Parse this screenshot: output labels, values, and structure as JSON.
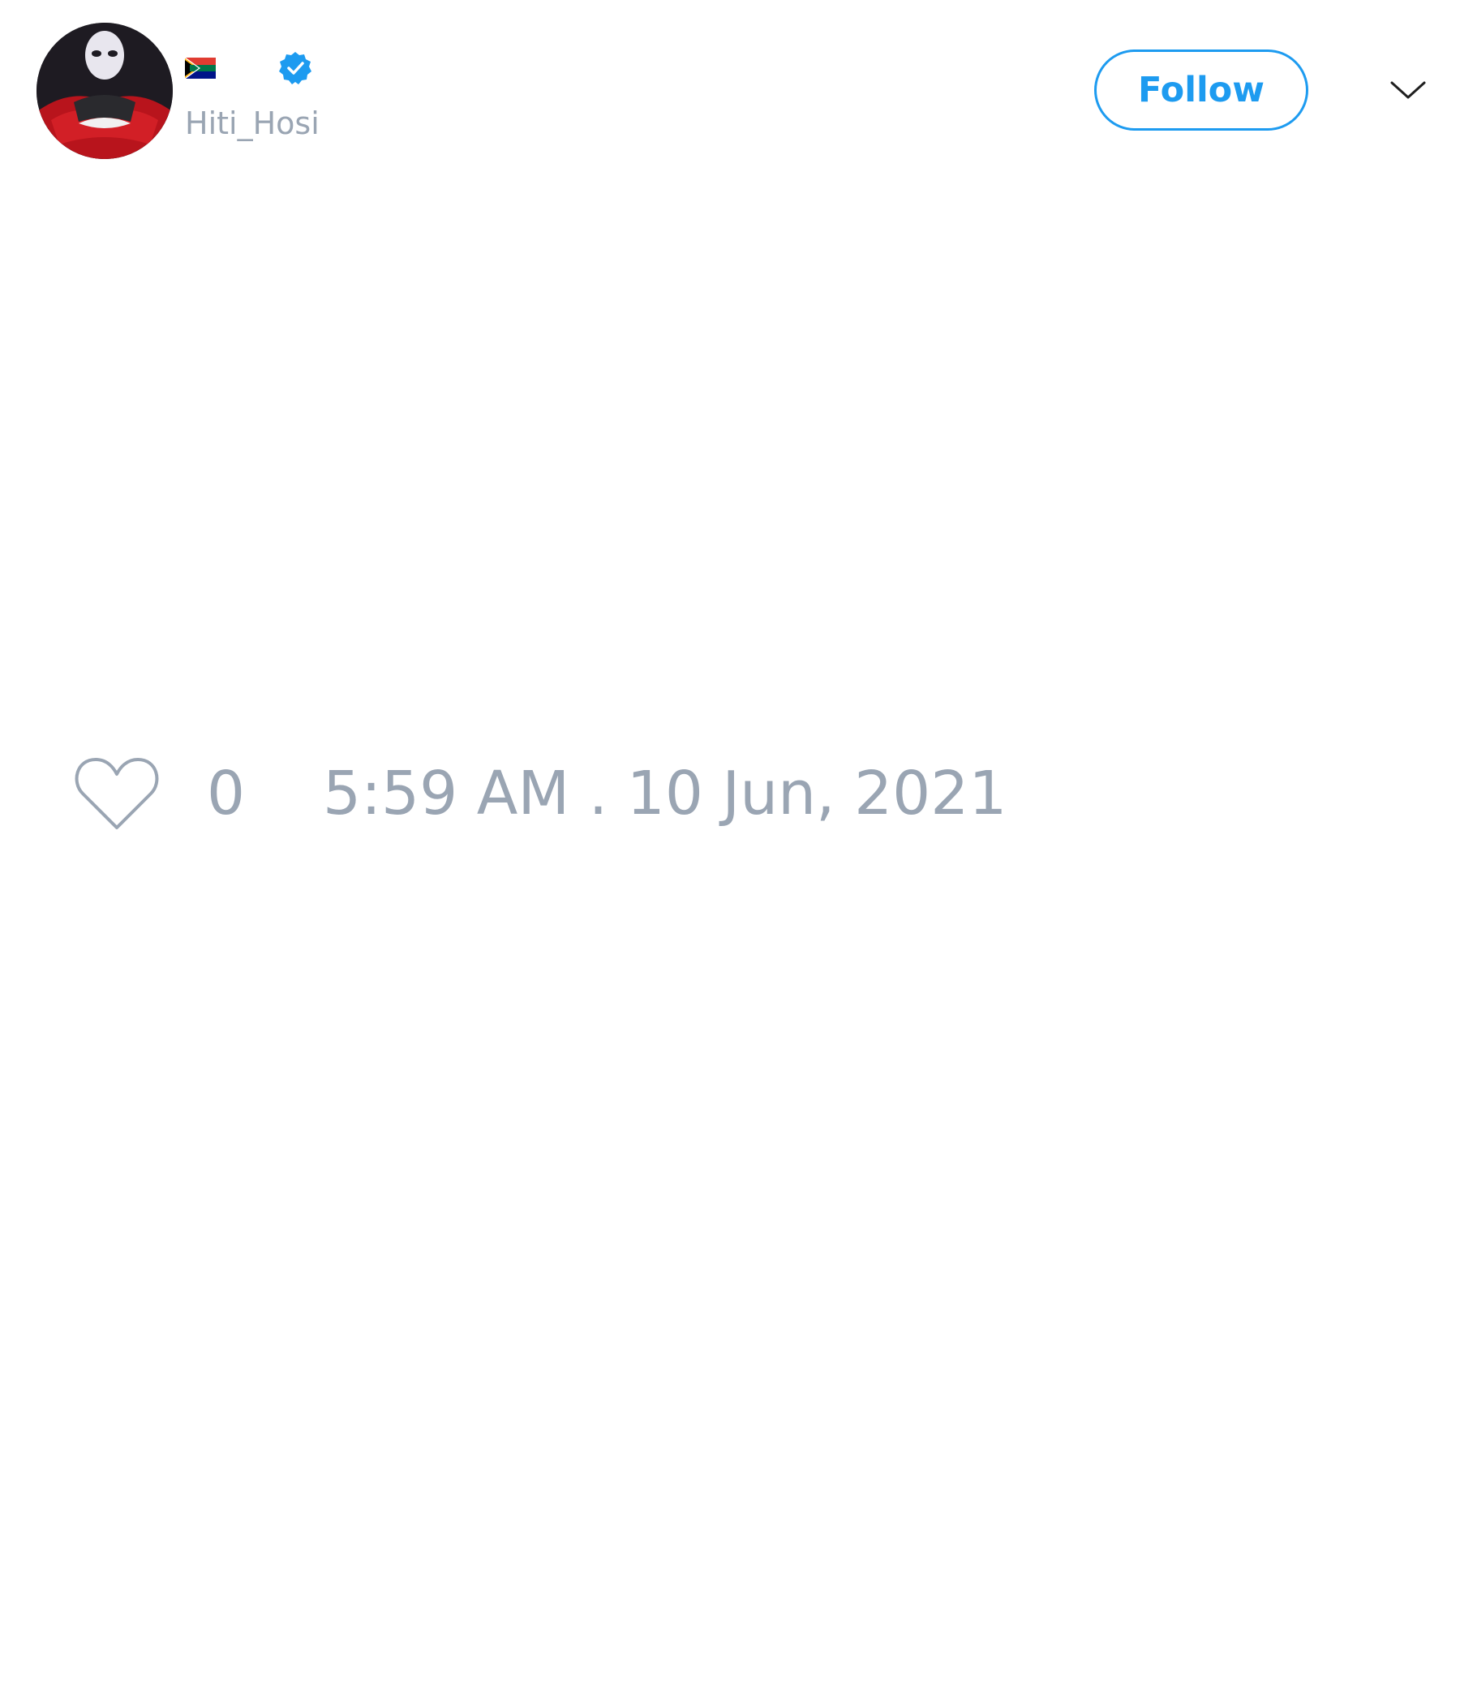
{
  "tweet": {
    "author": {
      "flag_emoji": "🇿🇦",
      "verified_icon": "verified-badge-icon",
      "handle": "Hiti_Hosi",
      "avatar_icon": "avatar-image"
    },
    "follow_label": "Follow",
    "menu_icon": "chevron-down-icon",
    "like_icon": "heart-outline-icon",
    "like_count": "0",
    "timestamp": "5:59 AM . 10 Jun, 2021"
  },
  "colors": {
    "accent": "#1d9bf0",
    "muted_text": "#9aa5b3",
    "background": "#ffffff"
  }
}
